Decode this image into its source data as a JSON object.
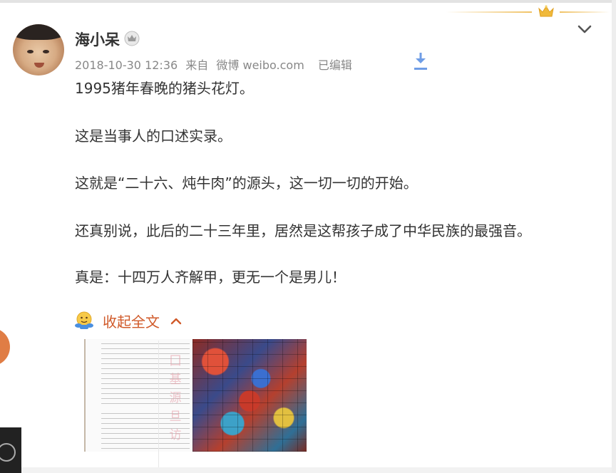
{
  "post": {
    "username": "海小呆",
    "timestamp": "2018-10-30 12:36",
    "source_prefix": "来自",
    "source": "微博 weibo.com",
    "edited": "已编辑"
  },
  "icons": {
    "vip": "crown-badge-icon",
    "crown": "gold-crown-icon",
    "expand": "chevron-down-icon",
    "download": "download-icon",
    "collapse_emoji": "hug-emoji-icon",
    "collapse_arrow": "chevron-up-icon"
  },
  "content": {
    "paragraphs": [
      "1995猪年春晚的猪头花灯。",
      "这是当事人的口述实录。",
      "这就是“二十六、炖牛肉”的源头，这一切一切的开始。",
      "还真别说，此后的二十三年里，居然是这帮孩子成了中华民族的最强音。",
      "真是：十四万人齐解甲，更无一个是男儿！"
    ]
  },
  "actions": {
    "collapse_label": "收起全文"
  },
  "images": {
    "thumb_1": "text-page-scan",
    "thumb_2": "video-frame-grid"
  },
  "watermark": {
    "chars": [
      "囗",
      "基",
      "源",
      "旦",
      "访"
    ]
  },
  "colors": {
    "accent": "#d05a2a",
    "crown": "#f0c264",
    "download": "#6f9de6",
    "meta_text": "#888888"
  }
}
